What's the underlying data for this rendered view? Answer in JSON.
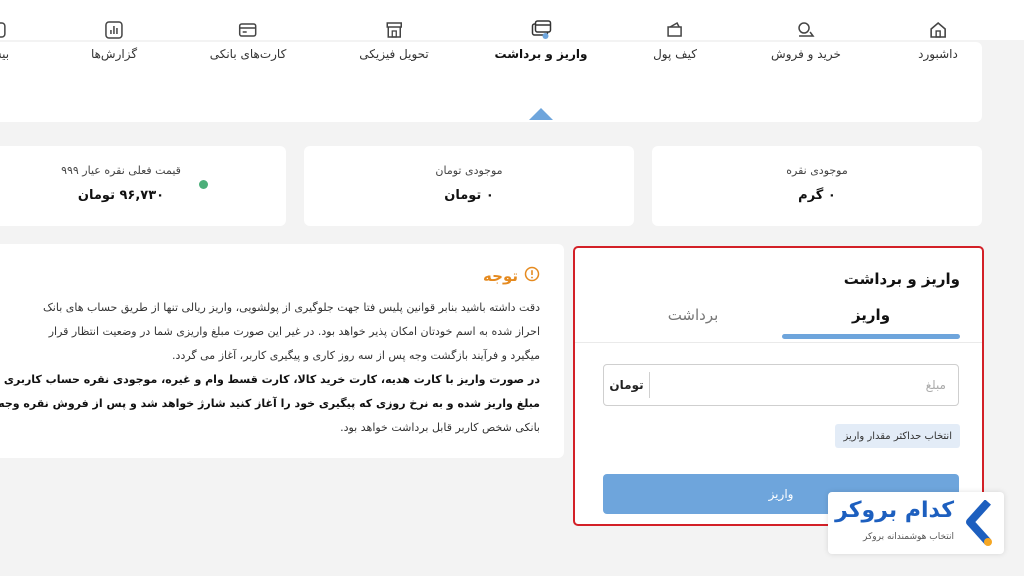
{
  "nav": {
    "tabs": [
      {
        "label": "داشبورد",
        "icon": "home-icon"
      },
      {
        "label": "خرید و فروش",
        "icon": "exchange-icon"
      },
      {
        "label": "کیف پول",
        "icon": "wallet-icon"
      },
      {
        "label": "واریز و برداشت",
        "icon": "cards-icon",
        "active": true
      },
      {
        "label": "تحویل فیزیکی",
        "icon": "store-icon"
      },
      {
        "label": "کارت‌های بانکی",
        "icon": "credit-card-icon"
      },
      {
        "label": "گزارش‌ها",
        "icon": "report-icon"
      },
      {
        "label": "بیش",
        "icon": "more-icon"
      }
    ]
  },
  "stats": {
    "silver_balance": {
      "title": "موجودی نقره",
      "value": "۰ گرم"
    },
    "toman_balance": {
      "title": "موجودی تومان",
      "value": "۰ تومان"
    },
    "silver_price": {
      "title": "قیمت فعلی نقره عیار ۹۹۹",
      "value": "۹۶,۷۳۰ تومان"
    }
  },
  "notice": {
    "title": "توجه",
    "lines": [
      "دقت داشته باشید بنابر قوانین پلیس فتا جهت جلوگیری از پولشویی، واریز ریالی تنها از طریق حساب های بانک",
      "احراز شده به اسم خودتان امکان پذیر خواهد بود. در غیر این صورت مبلغ واریزی شما در وضعیت انتظار قرار",
      "میگیرد و فرآیند بازگشت وجه پس از سه روز کاری و پیگیری کاربر، آغاز می گردد.",
      "در صورت واریز با کارت هدیه، کارت خرید کالا، کارت قسط وام و غیره، موجودی نقره حساب کاربری شما معادل",
      "مبلغ واریز شده و به نرخ روزی که پیگیری خود را آغاز کنید شارژ خواهد شد و پس از فروش نقره وجه به حساب",
      "بانکی شخص کاربر قابل برداشت خواهد بود."
    ]
  },
  "panel": {
    "title": "واریز و برداشت",
    "tab_deposit": "واریز",
    "tab_withdraw": "برداشت",
    "amount_placeholder": "مبلغ",
    "amount_value": "",
    "unit": "تومان",
    "max_button": "انتخاب حداکثر مقدار واریز",
    "submit_button": "واریز"
  },
  "logo": {
    "title": "کدام بروکر",
    "subtitle": "انتخاب هوشمندانه بروکر"
  },
  "colors": {
    "accent": "#6ea5dc",
    "highlight_border": "#d32027",
    "warning": "#e58a1f",
    "status_dot": "#4caf7a",
    "brand": "#1d5fbf"
  }
}
